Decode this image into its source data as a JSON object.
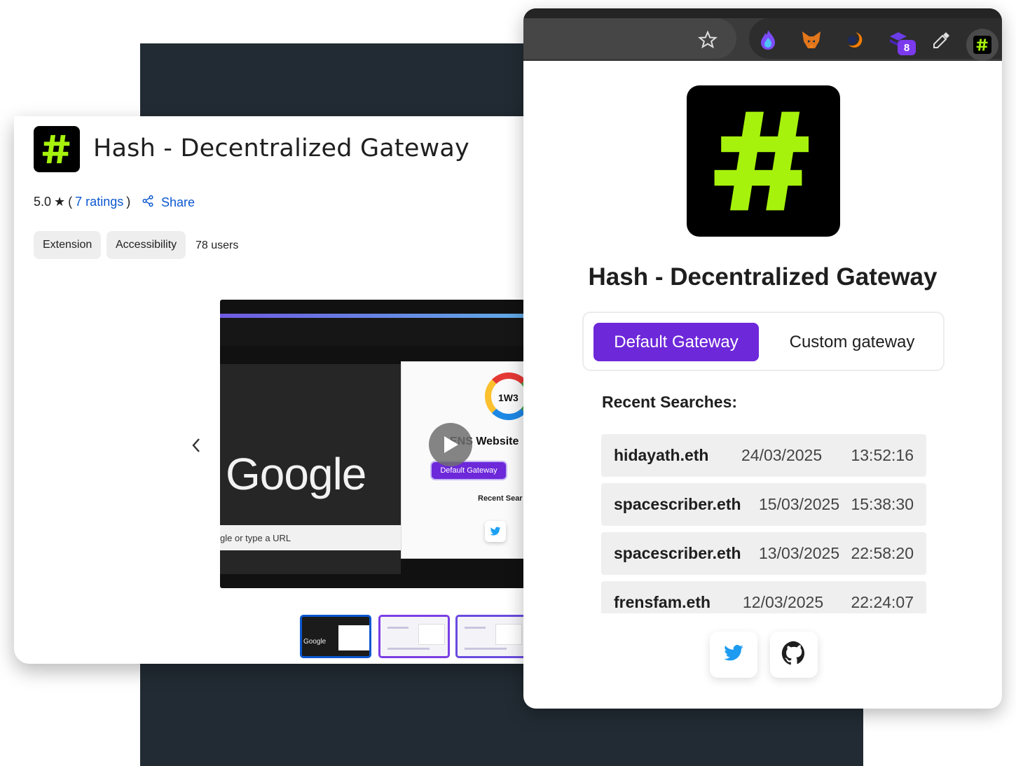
{
  "store": {
    "title": "Hash - Decentralized Gateway",
    "rating": "5.0",
    "ratings_link": "7 ratings",
    "share_label": "Share",
    "chips": [
      "Extension",
      "Accessibility"
    ],
    "users": "78 users"
  },
  "video": {
    "google_text": "Google",
    "url_hint": "gle or type a URL",
    "ring_text": "1W3",
    "ens_text": "ENS Website",
    "button_label": "Default Gateway",
    "recent_text": "Recent Sear",
    "thumb_google": "Google"
  },
  "popup": {
    "title": "Hash - Decentralized Gateway",
    "tabs": [
      {
        "label": "Default Gateway",
        "active": true
      },
      {
        "label": "Custom gateway",
        "active": false
      }
    ],
    "recent_heading": "Recent Searches:",
    "searches": [
      {
        "name": "hidayath.eth",
        "date": "24/03/2025",
        "time": "13:52:16"
      },
      {
        "name": "spacescriber.eth",
        "date": "15/03/2025",
        "time": "15:38:30"
      },
      {
        "name": "spacescriber.eth",
        "date": "13/03/2025",
        "time": "22:58:20"
      },
      {
        "name": "frensfam.eth",
        "date": "12/03/2025",
        "time": "22:24:07"
      }
    ],
    "extension_badge": "8"
  },
  "icons": [
    "hash-logo-icon",
    "star-icon",
    "share-icon",
    "chevron-left-icon",
    "play-icon",
    "bookmark-star-icon",
    "flame-icon",
    "fox-icon",
    "crescent-icon",
    "stack-icon",
    "eyedropper-icon",
    "twitter-icon",
    "github-icon"
  ],
  "colors": {
    "accent": "#6d28d9",
    "link": "#0b57d0",
    "hash_green": "#a6f20d",
    "backdrop": "#222b33"
  }
}
